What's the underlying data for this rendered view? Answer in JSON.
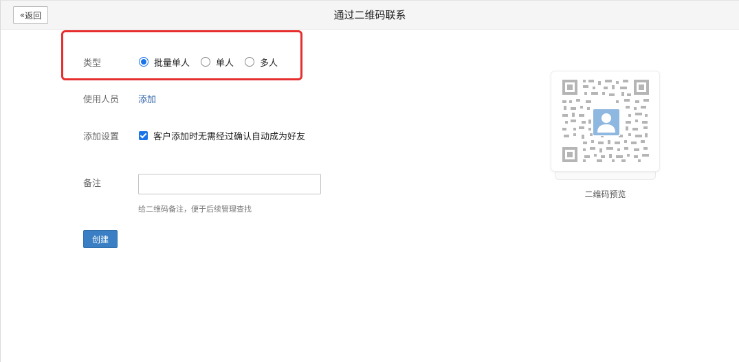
{
  "header": {
    "back_label": "返回",
    "title": "通过二维码联系"
  },
  "form": {
    "type": {
      "label": "类型",
      "options": [
        "批量单人",
        "单人",
        "多人"
      ],
      "selected": "批量单人"
    },
    "users": {
      "label": "使用人员",
      "add_link": "添加"
    },
    "add_settings": {
      "label": "添加设置",
      "checkbox_label": "客户添加时无需经过确认自动成为好友",
      "checked": true
    },
    "note": {
      "label": "备注",
      "value": "",
      "placeholder": "",
      "hint": "给二维码备注，便于后续管理查找"
    },
    "create_label": "创建"
  },
  "preview": {
    "caption": "二维码预览"
  },
  "colors": {
    "accent": "#1a73e8",
    "highlight": "#e62e2e",
    "button": "#3a7fc4",
    "link": "#2b5fa8"
  }
}
